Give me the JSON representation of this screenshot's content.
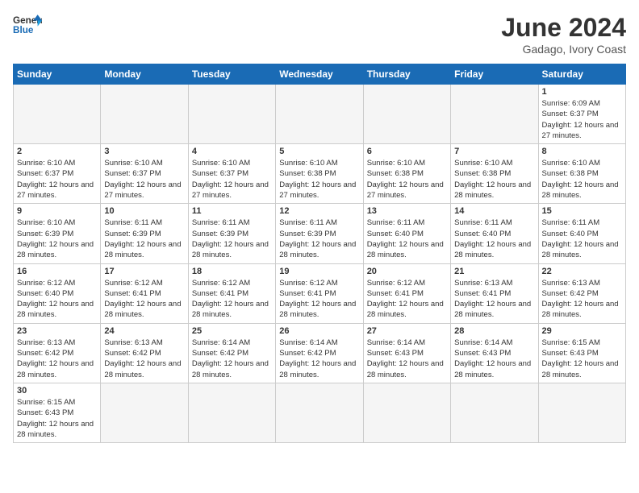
{
  "header": {
    "logo_general": "General",
    "logo_blue": "Blue",
    "title": "June 2024",
    "subtitle": "Gadago, Ivory Coast"
  },
  "days_of_week": [
    "Sunday",
    "Monday",
    "Tuesday",
    "Wednesday",
    "Thursday",
    "Friday",
    "Saturday"
  ],
  "weeks": [
    [
      {
        "day": "",
        "info": ""
      },
      {
        "day": "",
        "info": ""
      },
      {
        "day": "",
        "info": ""
      },
      {
        "day": "",
        "info": ""
      },
      {
        "day": "",
        "info": ""
      },
      {
        "day": "",
        "info": ""
      },
      {
        "day": "1",
        "info": "Sunrise: 6:09 AM\nSunset: 6:37 PM\nDaylight: 12 hours and 27 minutes."
      }
    ],
    [
      {
        "day": "2",
        "info": "Sunrise: 6:10 AM\nSunset: 6:37 PM\nDaylight: 12 hours and 27 minutes."
      },
      {
        "day": "3",
        "info": "Sunrise: 6:10 AM\nSunset: 6:37 PM\nDaylight: 12 hours and 27 minutes."
      },
      {
        "day": "4",
        "info": "Sunrise: 6:10 AM\nSunset: 6:37 PM\nDaylight: 12 hours and 27 minutes."
      },
      {
        "day": "5",
        "info": "Sunrise: 6:10 AM\nSunset: 6:38 PM\nDaylight: 12 hours and 27 minutes."
      },
      {
        "day": "6",
        "info": "Sunrise: 6:10 AM\nSunset: 6:38 PM\nDaylight: 12 hours and 27 minutes."
      },
      {
        "day": "7",
        "info": "Sunrise: 6:10 AM\nSunset: 6:38 PM\nDaylight: 12 hours and 28 minutes."
      },
      {
        "day": "8",
        "info": "Sunrise: 6:10 AM\nSunset: 6:38 PM\nDaylight: 12 hours and 28 minutes."
      }
    ],
    [
      {
        "day": "9",
        "info": "Sunrise: 6:10 AM\nSunset: 6:39 PM\nDaylight: 12 hours and 28 minutes."
      },
      {
        "day": "10",
        "info": "Sunrise: 6:11 AM\nSunset: 6:39 PM\nDaylight: 12 hours and 28 minutes."
      },
      {
        "day": "11",
        "info": "Sunrise: 6:11 AM\nSunset: 6:39 PM\nDaylight: 12 hours and 28 minutes."
      },
      {
        "day": "12",
        "info": "Sunrise: 6:11 AM\nSunset: 6:39 PM\nDaylight: 12 hours and 28 minutes."
      },
      {
        "day": "13",
        "info": "Sunrise: 6:11 AM\nSunset: 6:40 PM\nDaylight: 12 hours and 28 minutes."
      },
      {
        "day": "14",
        "info": "Sunrise: 6:11 AM\nSunset: 6:40 PM\nDaylight: 12 hours and 28 minutes."
      },
      {
        "day": "15",
        "info": "Sunrise: 6:11 AM\nSunset: 6:40 PM\nDaylight: 12 hours and 28 minutes."
      }
    ],
    [
      {
        "day": "16",
        "info": "Sunrise: 6:12 AM\nSunset: 6:40 PM\nDaylight: 12 hours and 28 minutes."
      },
      {
        "day": "17",
        "info": "Sunrise: 6:12 AM\nSunset: 6:41 PM\nDaylight: 12 hours and 28 minutes."
      },
      {
        "day": "18",
        "info": "Sunrise: 6:12 AM\nSunset: 6:41 PM\nDaylight: 12 hours and 28 minutes."
      },
      {
        "day": "19",
        "info": "Sunrise: 6:12 AM\nSunset: 6:41 PM\nDaylight: 12 hours and 28 minutes."
      },
      {
        "day": "20",
        "info": "Sunrise: 6:12 AM\nSunset: 6:41 PM\nDaylight: 12 hours and 28 minutes."
      },
      {
        "day": "21",
        "info": "Sunrise: 6:13 AM\nSunset: 6:41 PM\nDaylight: 12 hours and 28 minutes."
      },
      {
        "day": "22",
        "info": "Sunrise: 6:13 AM\nSunset: 6:42 PM\nDaylight: 12 hours and 28 minutes."
      }
    ],
    [
      {
        "day": "23",
        "info": "Sunrise: 6:13 AM\nSunset: 6:42 PM\nDaylight: 12 hours and 28 minutes."
      },
      {
        "day": "24",
        "info": "Sunrise: 6:13 AM\nSunset: 6:42 PM\nDaylight: 12 hours and 28 minutes."
      },
      {
        "day": "25",
        "info": "Sunrise: 6:14 AM\nSunset: 6:42 PM\nDaylight: 12 hours and 28 minutes."
      },
      {
        "day": "26",
        "info": "Sunrise: 6:14 AM\nSunset: 6:42 PM\nDaylight: 12 hours and 28 minutes."
      },
      {
        "day": "27",
        "info": "Sunrise: 6:14 AM\nSunset: 6:43 PM\nDaylight: 12 hours and 28 minutes."
      },
      {
        "day": "28",
        "info": "Sunrise: 6:14 AM\nSunset: 6:43 PM\nDaylight: 12 hours and 28 minutes."
      },
      {
        "day": "29",
        "info": "Sunrise: 6:15 AM\nSunset: 6:43 PM\nDaylight: 12 hours and 28 minutes."
      }
    ],
    [
      {
        "day": "30",
        "info": "Sunrise: 6:15 AM\nSunset: 6:43 PM\nDaylight: 12 hours and 28 minutes."
      },
      {
        "day": "",
        "info": ""
      },
      {
        "day": "",
        "info": ""
      },
      {
        "day": "",
        "info": ""
      },
      {
        "day": "",
        "info": ""
      },
      {
        "day": "",
        "info": ""
      },
      {
        "day": "",
        "info": ""
      }
    ]
  ]
}
